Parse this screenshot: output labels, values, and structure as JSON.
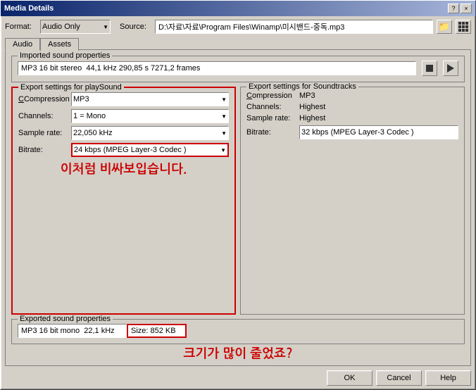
{
  "window": {
    "title": "Media Details",
    "title_btn_close": "×",
    "title_btn_help": "?"
  },
  "format_row": {
    "format_label": "Format:",
    "format_value": "Audio Only",
    "source_label": "Source:",
    "source_value": "D:\\자료\\자료\\Program Files\\Winamp\\미시밴드-중독.mp3"
  },
  "tabs": {
    "audio_label": "Audio",
    "assets_label": "Assets"
  },
  "imported_sound": {
    "legend": "Imported sound properties",
    "value": "MP3 16 bit stereo  44,1 kHz 290,85 s 7271,2 frames"
  },
  "export_playsound": {
    "legend": "Export settings for playSound",
    "compression_label": "Compression",
    "compression_value": "MP3",
    "channels_label": "Channels:",
    "channels_value": "1 = Mono",
    "sample_rate_label": "Sample rate:",
    "sample_rate_value": "22,050 kHz",
    "bitrate_label": "Bitrate:",
    "bitrate_value": "24 kbps (MPEG Layer-3 Codec )"
  },
  "export_soundtracks": {
    "legend": "Export settings for Soundtracks",
    "compression_label": "Compression",
    "compression_value": "MP3",
    "channels_label": "Channels:",
    "channels_value": "Highest",
    "sample_rate_label": "Sample rate:",
    "sample_rate_value": "Highest",
    "bitrate_label": "Bitrate:",
    "bitrate_value": "32 kbps (MPEG Layer-3 Codec )"
  },
  "korean_top": "이처럼 비싸보입습니다.",
  "exported_sound": {
    "legend": "Exported sound properties",
    "value": "MP3 16 bit mono  22,1 kHz",
    "size_label": "Size: 852 KB"
  },
  "korean_bottom": "크기가 많이 줄었죠?",
  "buttons": {
    "ok_label": "OK",
    "cancel_label": "Cancel",
    "help_label": "Help"
  }
}
